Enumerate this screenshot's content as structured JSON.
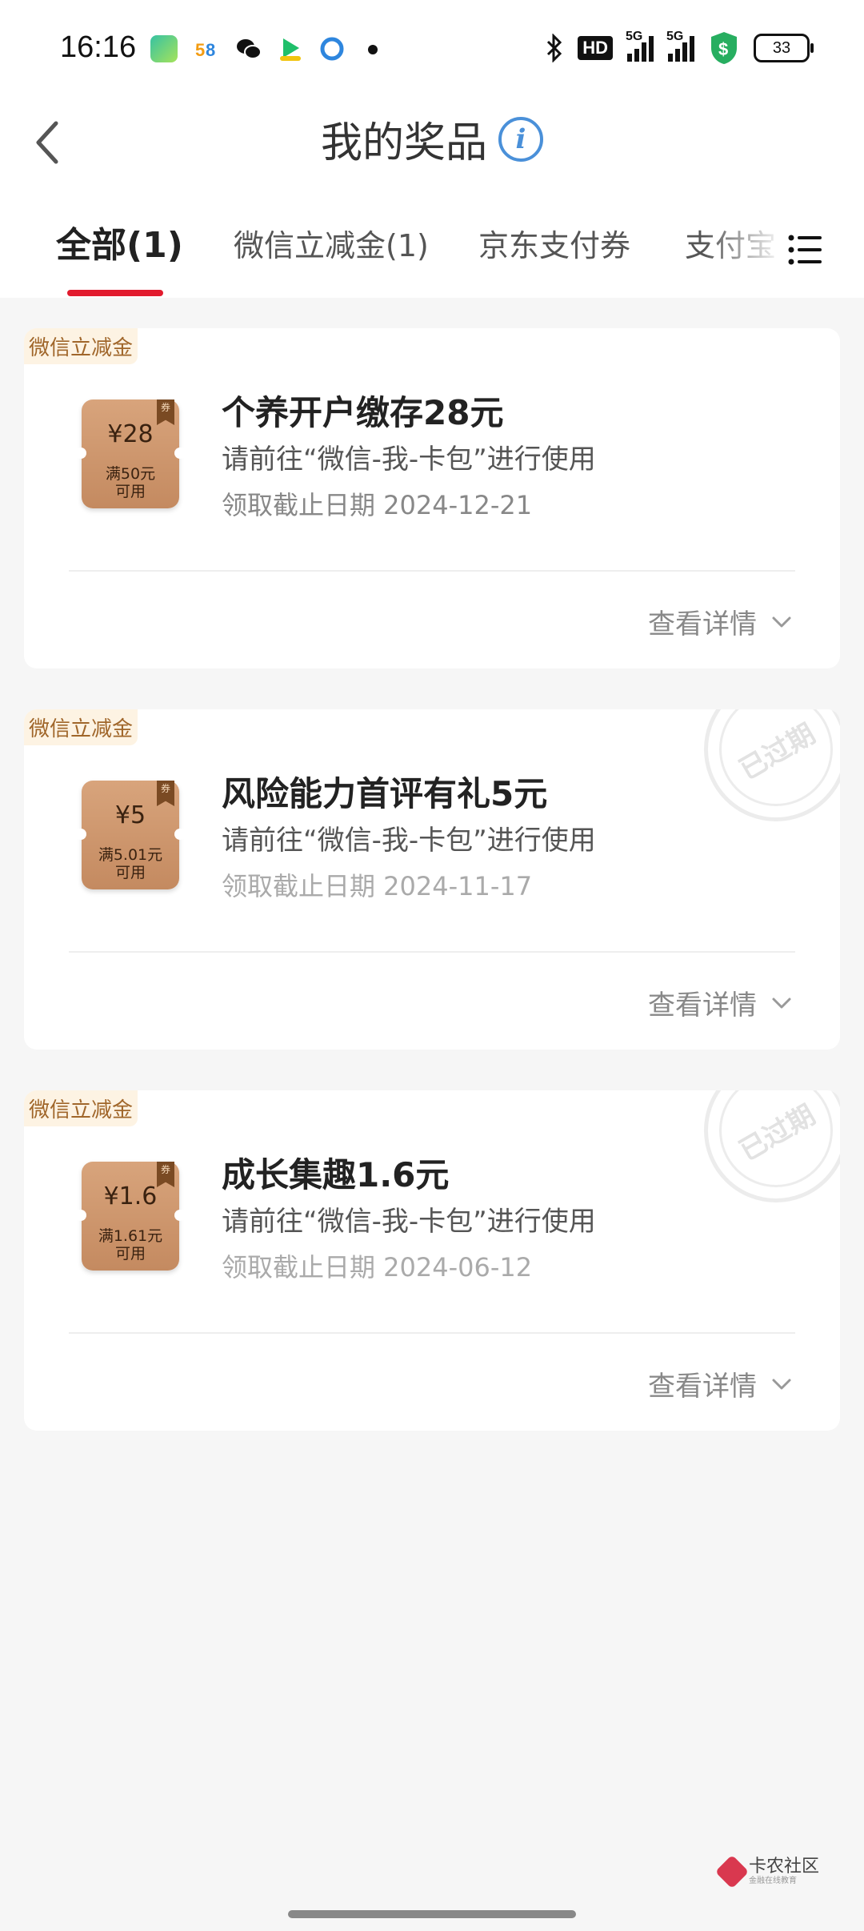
{
  "status_bar": {
    "time": "16:16",
    "network_label": "HD",
    "signal_label_1": "5G",
    "signal_label_2": "5G",
    "battery": "33"
  },
  "header": {
    "title": "我的奖品",
    "info_icon": "i"
  },
  "tabs": [
    {
      "label": "全部(1)",
      "active": true
    },
    {
      "label": "微信立减金(1)",
      "active": false
    },
    {
      "label": "京东支付券",
      "active": false
    },
    {
      "label": "支付宝",
      "active": false
    }
  ],
  "cards": [
    {
      "tag": "微信立减金",
      "coupon_amount": "¥28",
      "coupon_condition_1": "满50元",
      "coupon_condition_2": "可用",
      "coupon_mark": "券",
      "name": "个养开户缴存28元",
      "desc": "请前往“微信-我-卡包”进行使用",
      "date": "领取截止日期 2024-12-21",
      "detail": "查看详情",
      "expired": false
    },
    {
      "tag": "微信立减金",
      "coupon_amount": "¥5",
      "coupon_condition_1": "满5.01元",
      "coupon_condition_2": "可用",
      "coupon_mark": "券",
      "name": "风险能力首评有礼5元",
      "desc": "请前往“微信-我-卡包”进行使用",
      "date": "领取截止日期 2024-11-17",
      "detail": "查看详情",
      "expired": true,
      "stamp": "已过期"
    },
    {
      "tag": "微信立减金",
      "coupon_amount": "¥1.6",
      "coupon_condition_1": "满1.61元",
      "coupon_condition_2": "可用",
      "coupon_mark": "券",
      "name": "成长集趣1.6元",
      "desc": "请前往“微信-我-卡包”进行使用",
      "date": "领取截止日期 2024-06-12",
      "detail": "查看详情",
      "expired": true,
      "stamp": "已过期"
    }
  ],
  "watermark": {
    "title": "卡农社区",
    "subtitle": "金融在线教育"
  },
  "colors": {
    "accent": "#e21b2e",
    "info": "#4a90d9",
    "coupon": "#c48a60"
  }
}
